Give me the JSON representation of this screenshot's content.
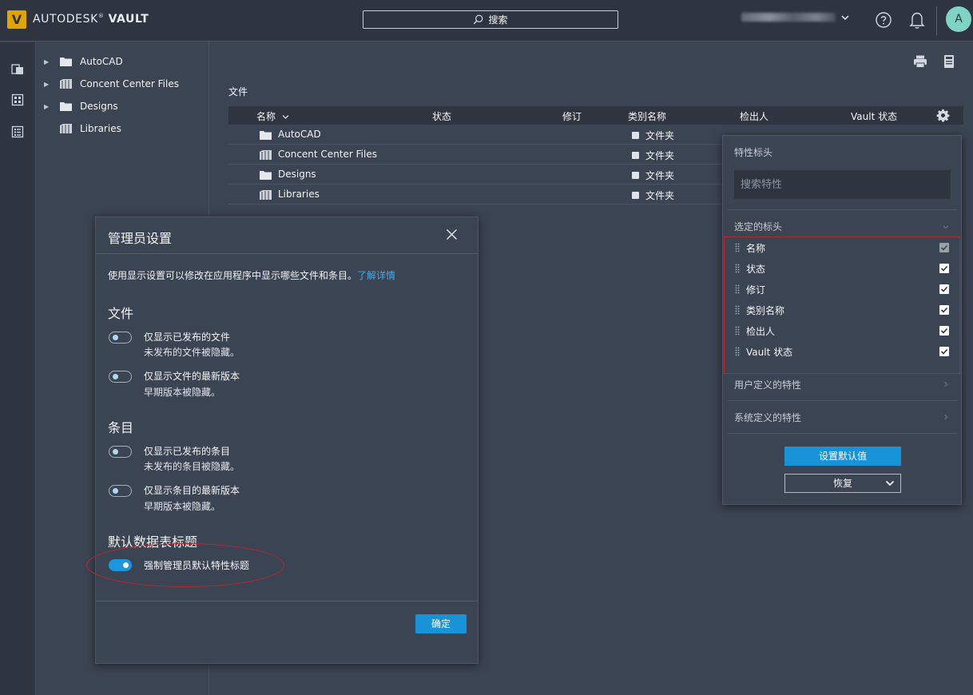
{
  "header": {
    "logo_letter": "V",
    "brand_prefix": "AUTODESK",
    "brand_name": "VAULT",
    "search_label": "搜索",
    "avatar_initial": "A"
  },
  "tree": {
    "items": [
      {
        "label": "AutoCAD",
        "icon": "folder-icon",
        "expandable": true
      },
      {
        "label": "Concent Center Files",
        "icon": "library-icon",
        "expandable": true
      },
      {
        "label": "Designs",
        "icon": "folder-icon",
        "expandable": true
      },
      {
        "label": "Libraries",
        "icon": "library-icon",
        "expandable": false
      }
    ]
  },
  "main": {
    "section_title": "文件",
    "columns": [
      "名称",
      "状态",
      "修订",
      "类别名称",
      "检出人",
      "Vault 状态"
    ],
    "rows": [
      {
        "name": "AutoCAD",
        "icon": "folder-icon",
        "category": "文件夹"
      },
      {
        "name": "Concent Center Files",
        "icon": "library-icon",
        "category": "文件夹"
      },
      {
        "name": "Designs",
        "icon": "folder-icon",
        "category": "文件夹"
      },
      {
        "name": "Libraries",
        "icon": "library-icon",
        "category": "文件夹"
      }
    ]
  },
  "dialog": {
    "title": "管理员设置",
    "description": "使用显示设置可以修改在应用程序中显示哪些文件和条目。",
    "learn_more": "了解详情",
    "files_section": "文件",
    "items_section": "条目",
    "default_section": "默认数据表标题",
    "options": [
      {
        "label": "仅显示已发布的文件",
        "sub": "未发布的文件被隐藏。",
        "on": false
      },
      {
        "label": "仅显示文件的最新版本",
        "sub": "早期版本被隐藏。",
        "on": false
      },
      {
        "label": "仅显示已发布的条目",
        "sub": "未发布的条目被隐藏。",
        "on": false
      },
      {
        "label": "仅显示条目的最新版本",
        "sub": "早期版本被隐藏。",
        "on": false
      },
      {
        "label": "强制管理员默认特性标题",
        "sub": "",
        "on": true
      }
    ],
    "ok_label": "确定"
  },
  "popover": {
    "title": "特性标头",
    "search_placeholder": "搜索特性",
    "selected_section": "选定的标头",
    "selected": [
      {
        "label": "名称",
        "checked": true,
        "locked": true
      },
      {
        "label": "状态",
        "checked": true,
        "locked": false
      },
      {
        "label": "修订",
        "checked": true,
        "locked": false
      },
      {
        "label": "类别名称",
        "checked": true,
        "locked": false
      },
      {
        "label": "检出人",
        "checked": true,
        "locked": false
      },
      {
        "label": "Vault 状态",
        "checked": true,
        "locked": false
      }
    ],
    "user_defined": "用户定义的特性",
    "system_defined": "系统定义的特性",
    "set_default": "设置默认值",
    "restore": "恢复"
  },
  "colors": {
    "accent": "#1993d7",
    "highlight_border": "#c0252b",
    "logo": "#e2a400",
    "avatar": "#7ed3c3"
  }
}
